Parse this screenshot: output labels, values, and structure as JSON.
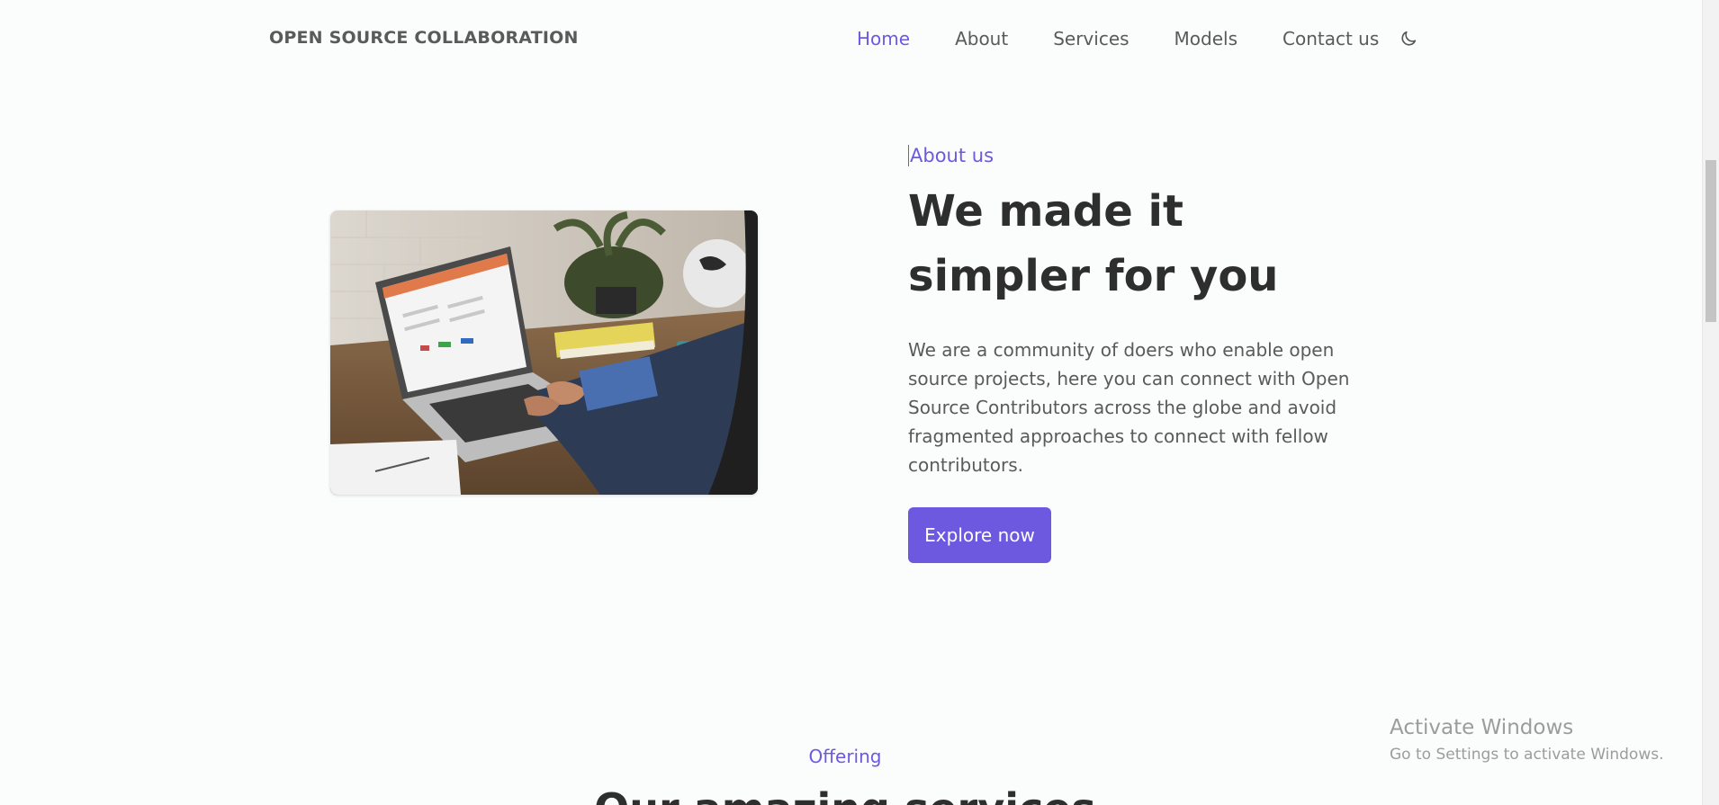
{
  "header": {
    "brand": "OPEN SOURCE COLLABORATION",
    "nav": [
      {
        "label": "Home",
        "active": true
      },
      {
        "label": "About",
        "active": false
      },
      {
        "label": "Services",
        "active": false
      },
      {
        "label": "Models",
        "active": false
      },
      {
        "label": "Contact us",
        "active": false
      }
    ],
    "theme_toggle_icon": "moon-icon"
  },
  "about": {
    "eyebrow": "About us",
    "headline": "We made it simpler for you",
    "description": "We are a community of doers who enable open source projects, here you can connect with Open Source Contributors across the globe and avoid fragmented approaches to connect with fellow contributors.",
    "cta_label": "Explore now",
    "image": "laptop-workspace-photo"
  },
  "offering": {
    "eyebrow": "Offering",
    "title": "Our amazing services"
  },
  "watermark": {
    "title": "Activate Windows",
    "subtitle": "Go to Settings to activate Windows."
  },
  "colors": {
    "accent": "#6c59e0",
    "text_dark": "#2e2e2e",
    "text_muted": "#5a5a5a",
    "background": "#fbfcfc"
  }
}
